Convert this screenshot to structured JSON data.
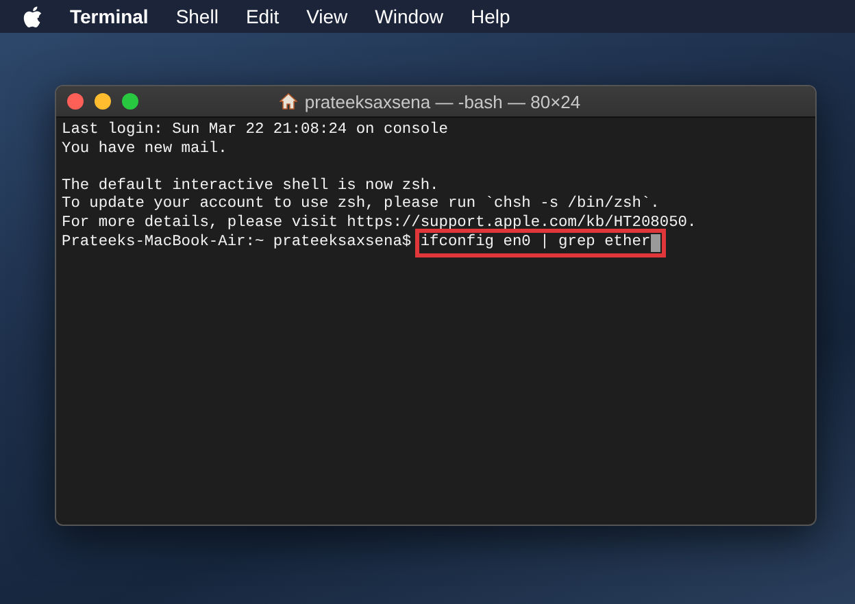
{
  "menu_bar": {
    "app_name": "Terminal",
    "items": [
      "Shell",
      "Edit",
      "View",
      "Window",
      "Help"
    ]
  },
  "window": {
    "title": "prateeksaxsena — -bash — 80×24"
  },
  "terminal": {
    "paragraphs": [
      [
        "Last login: Sun Mar 22 21:08:24 on console",
        "You have new mail."
      ],
      [
        "The default interactive shell is now zsh.",
        "To update your account to use zsh, please run `chsh -s /bin/zsh`.",
        "For more details, please visit https://support.apple.com/kb/HT208050."
      ]
    ],
    "prompt": "Prateeks-MacBook-Air:~ prateeksaxsena$",
    "command": "ifconfig en0 | grep ether",
    "command_highlighted": true
  }
}
